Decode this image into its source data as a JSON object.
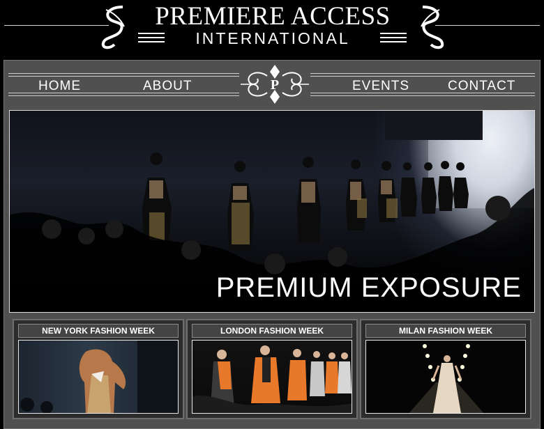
{
  "header": {
    "title_line1": "PREMIERE ACCESS",
    "title_line2": "INTERNATIONAL"
  },
  "nav": {
    "items": [
      {
        "label": "HOME"
      },
      {
        "label": "ABOUT"
      },
      {
        "label": "EVENTS"
      },
      {
        "label": "CONTACT"
      }
    ],
    "emblem_letter": "P"
  },
  "hero": {
    "caption": "PREMIUM EXPOSURE"
  },
  "cards": [
    {
      "title": "NEW YORK FASHION WEEK"
    },
    {
      "title": "LONDON FASHION WEEK"
    },
    {
      "title": "MILAN FASHION WEEK"
    }
  ],
  "colors": {
    "background": "#000000",
    "frame": "#505050",
    "text": "#ffffff",
    "accent_orange": "#e8782a"
  }
}
